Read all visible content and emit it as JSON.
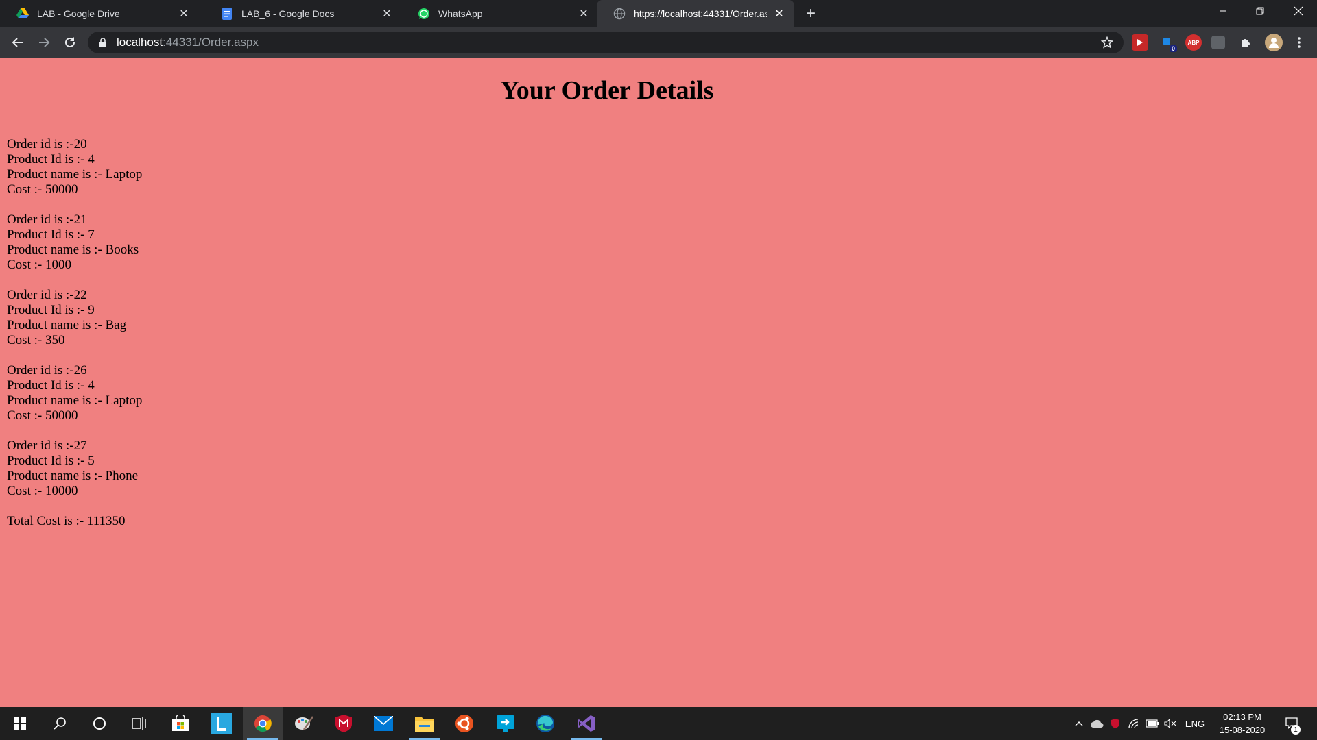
{
  "browser": {
    "tabs": [
      {
        "title": "LAB - Google Drive",
        "icon": "google-drive-icon",
        "active": false
      },
      {
        "title": "LAB_6 - Google Docs",
        "icon": "google-docs-icon",
        "active": false
      },
      {
        "title": "WhatsApp",
        "icon": "whatsapp-icon",
        "active": false
      },
      {
        "title": "https://localhost:44331/Order.aspx",
        "icon": "globe-icon",
        "active": true
      }
    ],
    "new_tab_label": "+",
    "address": {
      "host": "localhost",
      "rest": ":44331/Order.aspx"
    },
    "extensions": [
      {
        "name": "video-extension-icon",
        "label": ""
      },
      {
        "name": "extension-badge-icon",
        "label": "0"
      },
      {
        "name": "adblock-plus-icon",
        "label": "ABP"
      },
      {
        "name": "extension-square-icon",
        "label": ""
      },
      {
        "name": "extensions-puzzle-icon",
        "label": ""
      },
      {
        "name": "profile-avatar-icon",
        "label": ""
      }
    ]
  },
  "page": {
    "title": "Your Order Details",
    "orders": [
      {
        "order_id": "Order id is :-20",
        "product_id": "Product Id is :- 4",
        "product_name": "Product name is :- Laptop",
        "cost": "Cost :- 50000"
      },
      {
        "order_id": "Order id is :-21",
        "product_id": "Product Id is :- 7",
        "product_name": "Product name is :- Books",
        "cost": "Cost :- 1000"
      },
      {
        "order_id": "Order id is :-22",
        "product_id": "Product Id is :- 9",
        "product_name": "Product name is :- Bag",
        "cost": "Cost :- 350"
      },
      {
        "order_id": "Order id is :-26",
        "product_id": "Product Id is :- 4",
        "product_name": "Product name is :- Laptop",
        "cost": "Cost :- 50000"
      },
      {
        "order_id": "Order id is :-27",
        "product_id": "Product Id is :- 5",
        "product_name": "Product name is :- Phone",
        "cost": "Cost :- 10000"
      }
    ],
    "total": "Total Cost is :- 111350",
    "background_color": "#f08080"
  },
  "taskbar": {
    "language": "ENG",
    "time": "02:13 PM",
    "date": "15-08-2020",
    "notification_count": "1"
  }
}
